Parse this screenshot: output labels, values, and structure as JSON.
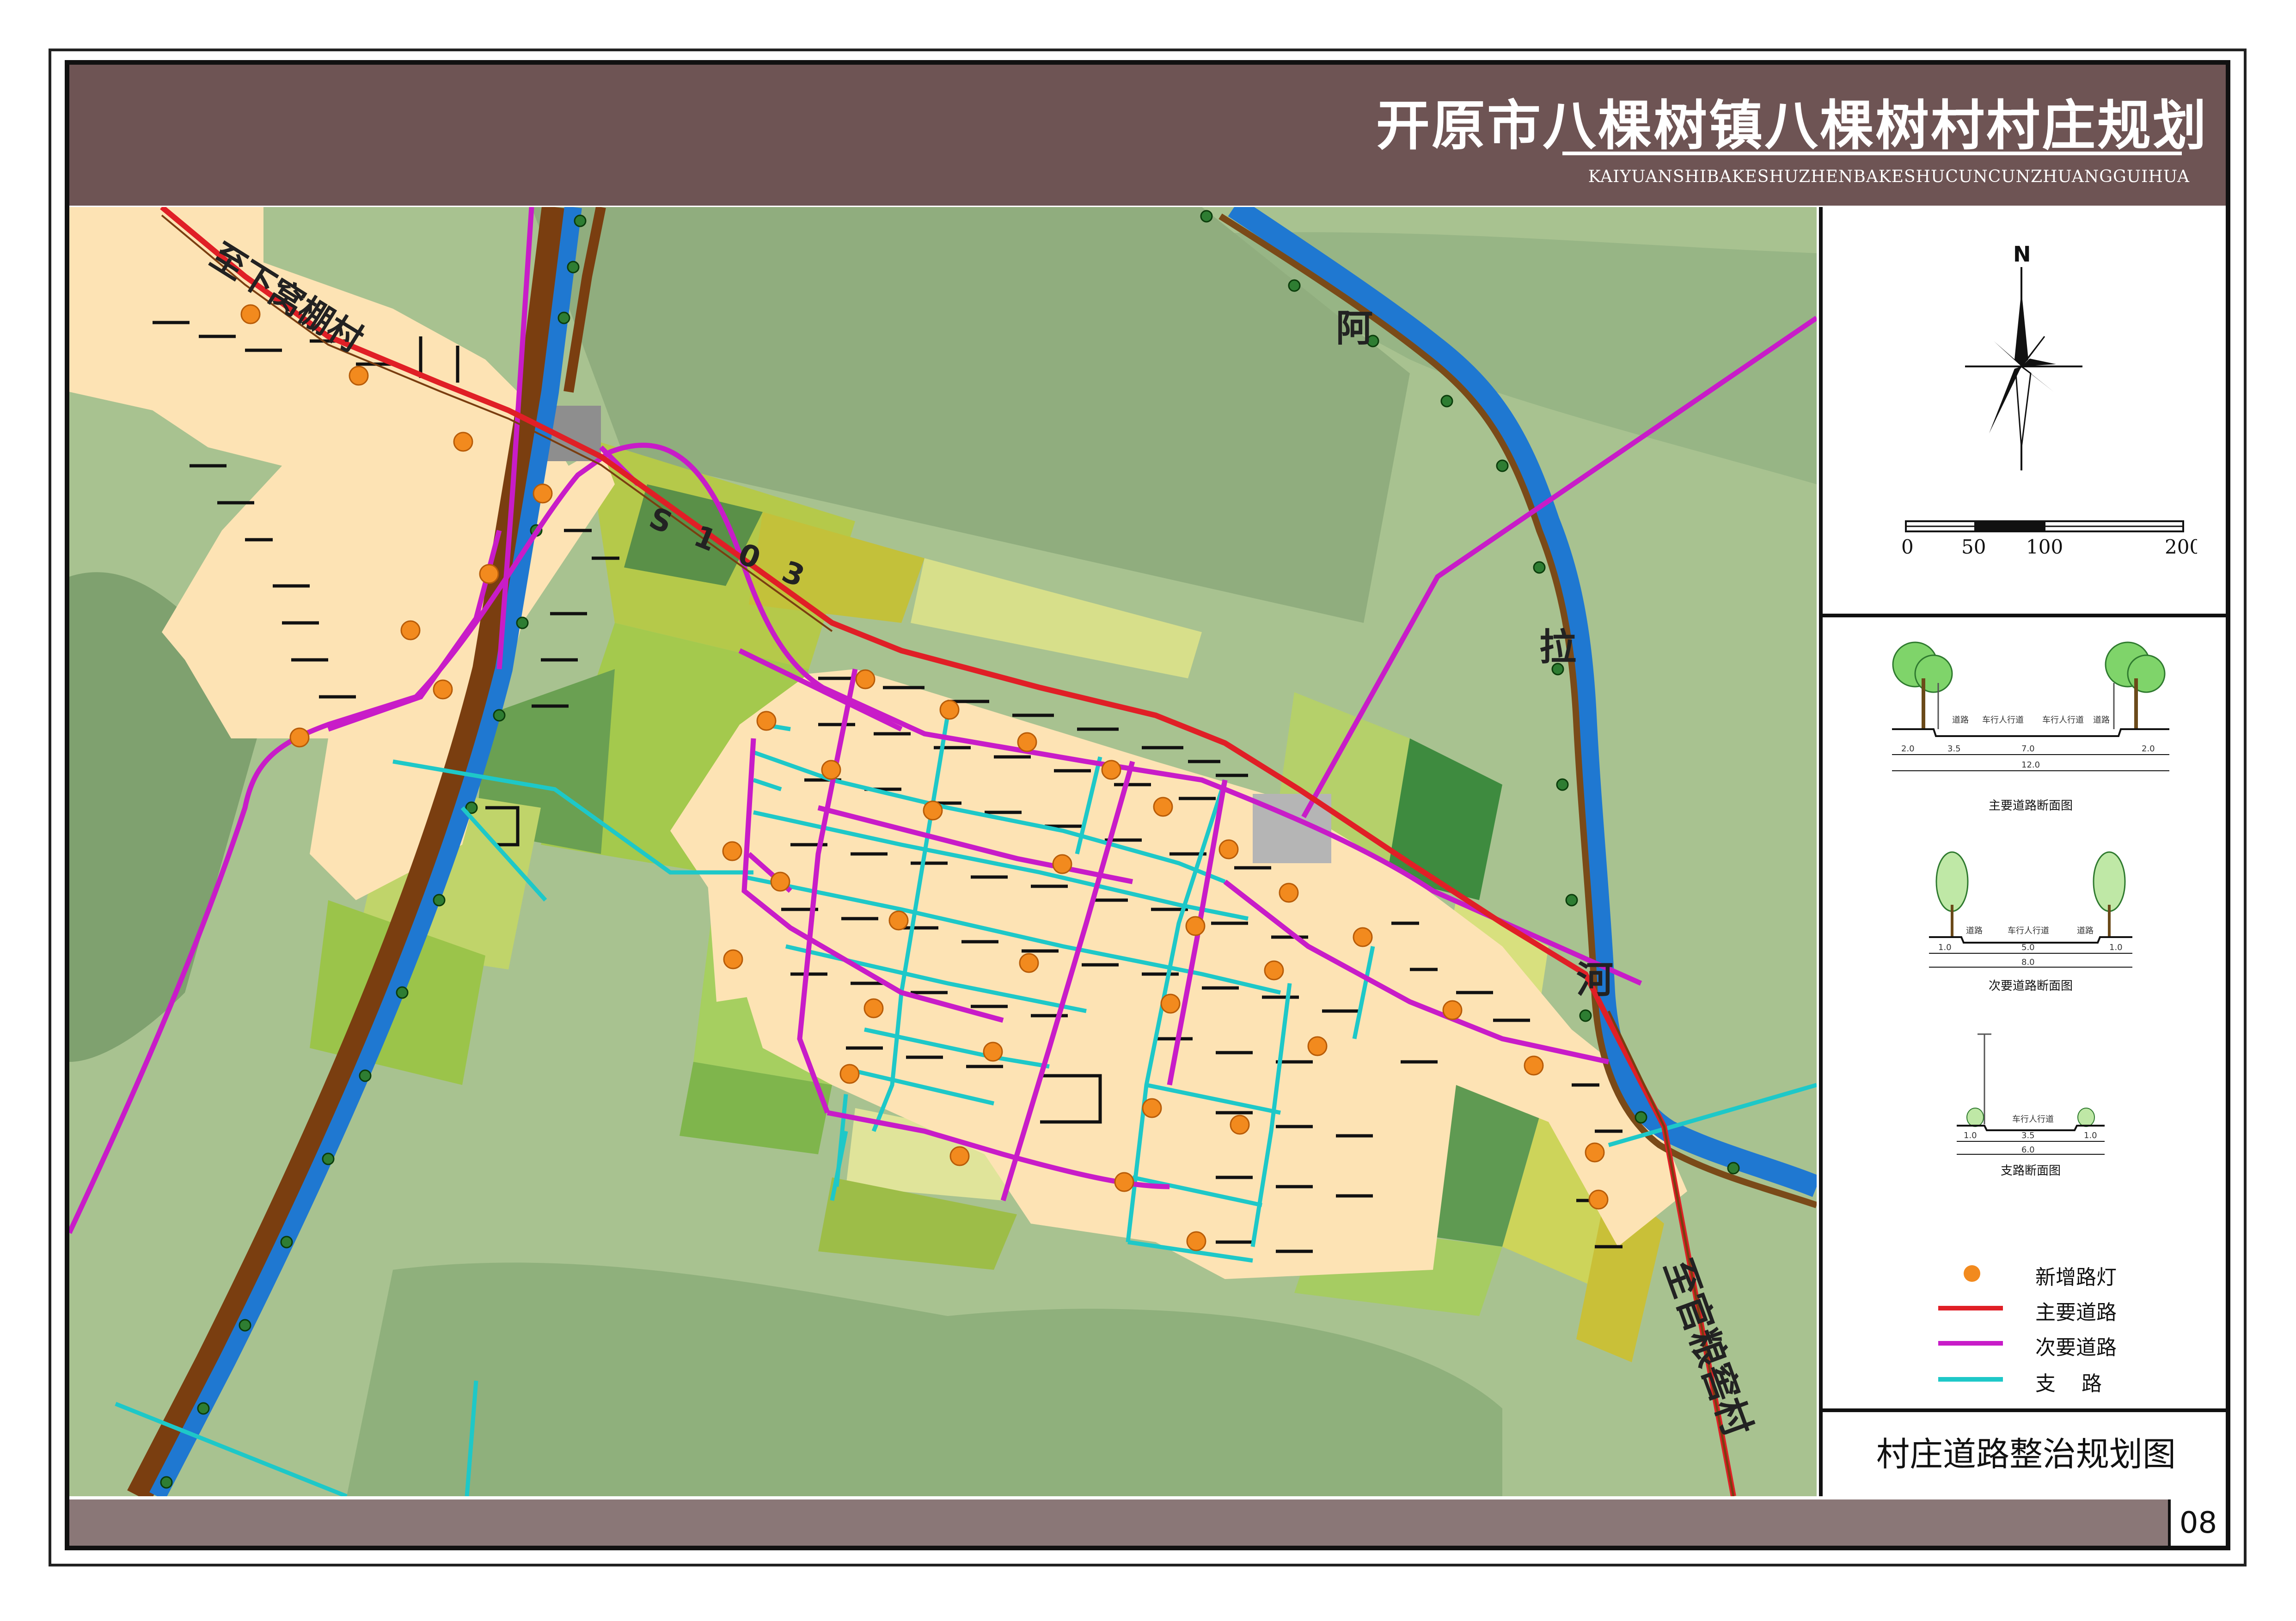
{
  "title": "开原市八棵树镇八棵树村村庄规划",
  "subtitle_latin": "KAIYUANSHIBAKESHUZHENBAKESHUCUNCUNZHUANGGUIHUA",
  "map_labels": {
    "road_to_xiawo": "至下窝棚村",
    "road_code": "S 1 0 3",
    "road_to_guanliang": "至官粮窖村",
    "river_a": "阿",
    "river_la": "拉",
    "river_he": "河"
  },
  "compass": {
    "north": "N"
  },
  "scale_bar": {
    "labels": [
      "0",
      "50",
      "100",
      "200"
    ]
  },
  "sections": [
    {
      "caption": "主要道路断面图",
      "top_labels": [
        "道路",
        "车行人行道",
        "车行人行道",
        "道路"
      ],
      "dims": [
        "2.0",
        "3.5",
        "7.0",
        "2.0"
      ],
      "total": "12.0"
    },
    {
      "caption": "次要道路断面图",
      "top_labels": [
        "道路",
        "车行人行道",
        "道路"
      ],
      "dims": [
        "1.0",
        "5.0",
        "1.0"
      ],
      "total": "8.0"
    },
    {
      "caption": "支路断面图",
      "top_labels": [
        "车行人行道"
      ],
      "dims": [
        "1.0",
        "3.5",
        "1.0"
      ],
      "total": "6.0"
    }
  ],
  "legend": [
    {
      "label": "新增路灯",
      "color": "#f28a1e",
      "kind": "dot"
    },
    {
      "label": "主要道路",
      "color": "#e01f26",
      "kind": "line"
    },
    {
      "label": "次要道路",
      "color": "#c81cc8",
      "kind": "line"
    },
    {
      "label": "支    路",
      "color": "#1ec8c8",
      "kind": "line"
    }
  ],
  "drawing_title": "村庄道路整治规划图",
  "sheet_number": "08",
  "colors": {
    "header": "#6e5454",
    "footer": "#8a7777",
    "main_road": "#e01f26",
    "secondary_road": "#c81cc8",
    "branch_road": "#1ec8c8",
    "street_light": "#f28a1e",
    "settlement": "#fde3b4",
    "river": "#1f78d1",
    "background_green": "#a5be8c"
  }
}
